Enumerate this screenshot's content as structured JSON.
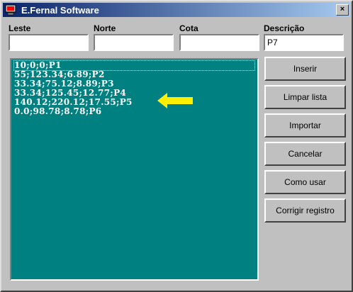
{
  "window": {
    "title": "E.Fernal Software",
    "close_glyph": "×"
  },
  "fields": {
    "leste_label": "Leste",
    "norte_label": "Norte",
    "cota_label": "Cota",
    "descricao_label": "Descrição",
    "leste_value": "",
    "norte_value": "",
    "cota_value": "",
    "descricao_value": "P7"
  },
  "list": {
    "items": [
      "10;0;0;P1",
      "55;123.34;6.89;P2",
      "33.34;75.12;8.89;P3",
      "33.34;125.45;12.77;P4",
      "140.12;220.12;17.55;P5",
      "0.0;98.78;8.78;P6"
    ],
    "highlight_color": "#ffee00",
    "background_color": "#008080"
  },
  "buttons": {
    "inserir": "Inserir",
    "limpar": "Limpar lista",
    "importar": "Importar",
    "cancelar": "Cancelar",
    "como_usar": "Como usar",
    "corrigir": "Corrigir registro"
  }
}
